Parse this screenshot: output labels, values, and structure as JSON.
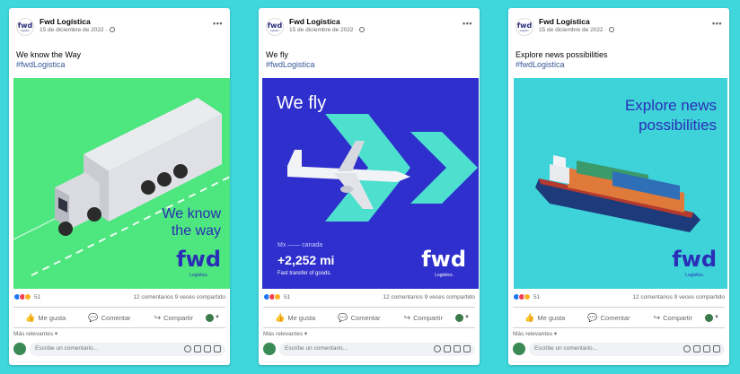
{
  "colors": {
    "background": "#3fd6dc",
    "brand_blue": "#2a2eb6",
    "link": "#385898"
  },
  "posts": [
    {
      "page_name": "Fwd Logística",
      "date": "15 de diciembre de 2022 ·",
      "caption": "We know the Way",
      "hashtag": "#fwdLogistica",
      "image": {
        "headline_line1": "We know",
        "headline_line2": "the way",
        "brand": "fwd",
        "brand_sub": "Logistics.",
        "illustration": "truck-icon"
      },
      "reactions_count": "51",
      "comments_shares": "12 comentarios  9 veces compartido"
    },
    {
      "page_name": "Fwd Logística",
      "date": "15 de diciembre de 2022 ·",
      "caption": "We fly",
      "hashtag": "#fwdLogistica",
      "image": {
        "headline": "We fly",
        "route": "Mx —— canada",
        "stat": "+2,252 mi",
        "note": "Fast transfer of goods.",
        "brand": "fwd",
        "brand_sub": "Logistics.",
        "illustration": "airplane-icon"
      },
      "reactions_count": "51",
      "comments_shares": "12 comentarios  9 veces compartido"
    },
    {
      "page_name": "Fwd Logística",
      "date": "15 de diciembre de 2022 ·",
      "caption": "Explore news possibilities",
      "hashtag": "#fwdLogistica",
      "image": {
        "headline_line1": "Explore news",
        "headline_line2": "possibilities",
        "brand": "fwd",
        "brand_sub": "Logistics.",
        "illustration": "cargo-ship-icon"
      },
      "reactions_count": "51",
      "comments_shares": "12 comentarios  9 veces compartido"
    }
  ],
  "actions": {
    "like": "Me gusta",
    "comment": "Comentar",
    "share": "Compartir"
  },
  "sort_label": "Más relevantes ▾",
  "comment_placeholder": "Escribe un comentario..."
}
